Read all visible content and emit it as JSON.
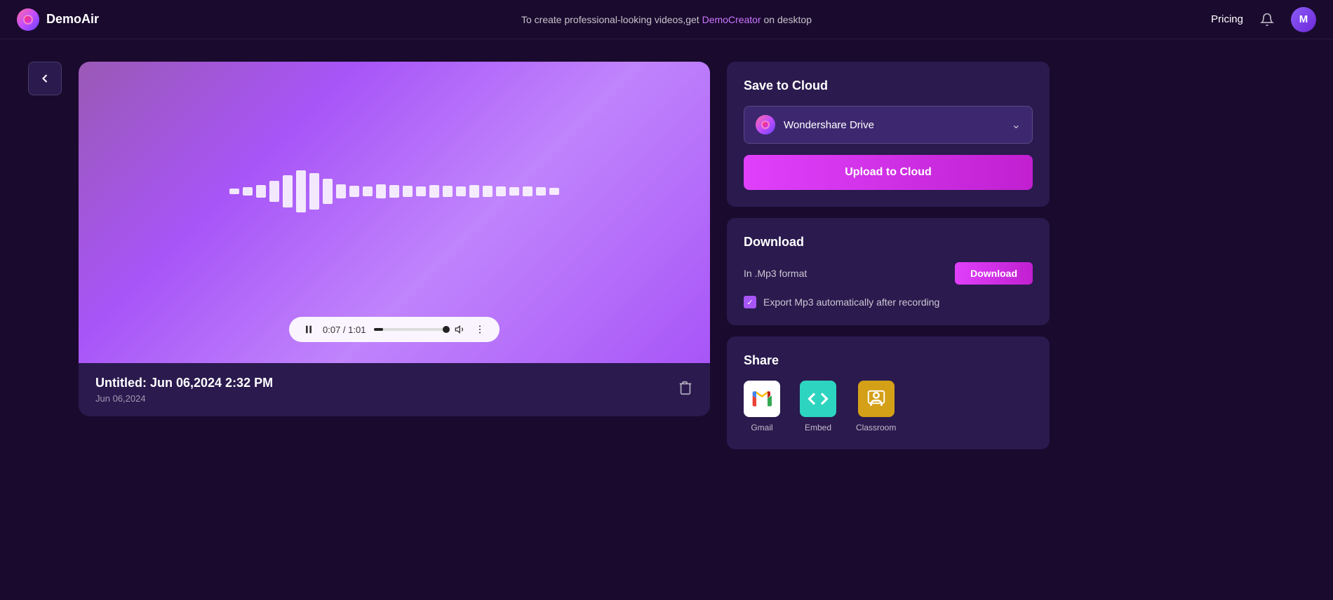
{
  "app": {
    "name": "DemoAir"
  },
  "header": {
    "promo_text": "To create professional-looking videos,get ",
    "promo_link": "DemoCreator",
    "promo_suffix": " on desktop",
    "pricing_label": "Pricing",
    "avatar_letter": "M"
  },
  "back_button": "‹",
  "media": {
    "title": "Untitled: Jun 06,2024 2:32 PM",
    "date": "Jun 06,2024",
    "current_time": "0:07",
    "total_time": "1:01",
    "time_display": "0:07 / 1:01",
    "progress_percent": 12
  },
  "waveform": {
    "bars": [
      8,
      12,
      18,
      30,
      46,
      60,
      52,
      36,
      20,
      16,
      14,
      20,
      18,
      16,
      14,
      18,
      16,
      14,
      18,
      16,
      14,
      12,
      14,
      12,
      10
    ]
  },
  "cloud": {
    "title": "Save to Cloud",
    "drive_name": "Wondershare Drive",
    "upload_button": "Upload to Cloud"
  },
  "download": {
    "title": "Download",
    "format_label": "In .Mp3 format",
    "download_button": "Download",
    "export_label": "Export Mp3 automatically after recording"
  },
  "share": {
    "title": "Share",
    "items": [
      {
        "name": "Gmail",
        "icon": "gmail-icon"
      },
      {
        "name": "Embed",
        "icon": "embed-icon"
      },
      {
        "name": "Classroom",
        "icon": "classroom-icon"
      }
    ]
  }
}
